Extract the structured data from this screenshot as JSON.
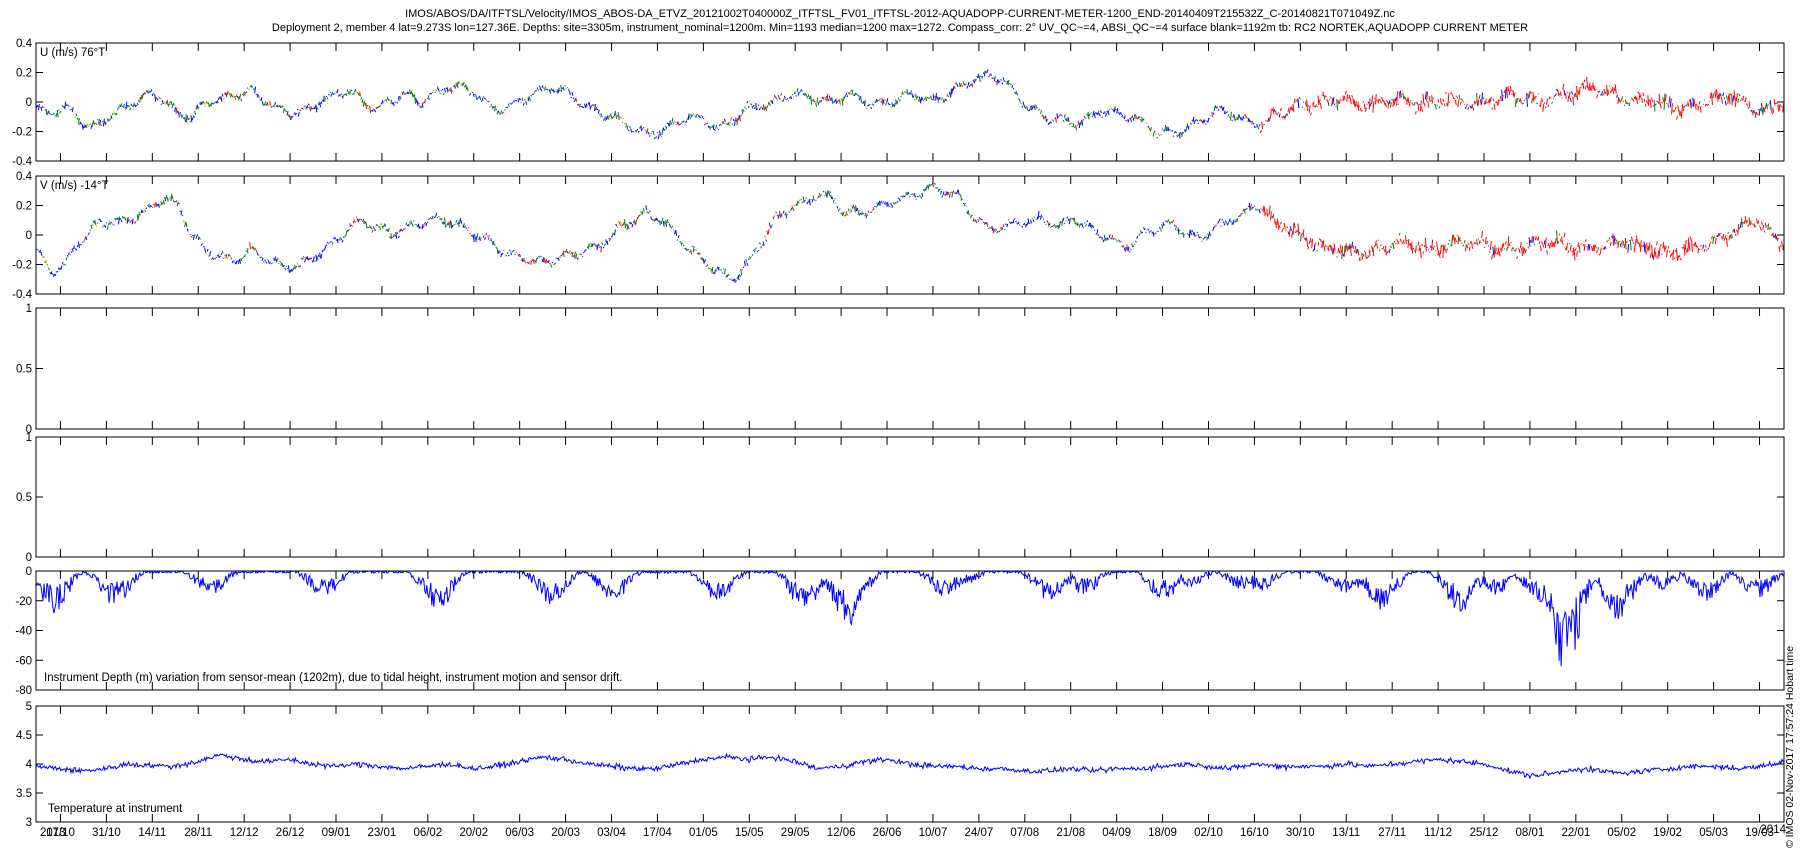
{
  "title_line1": "IMOS/ABOS/DA/ITFTSL/Velocity/IMOS_ABOS-DA_ETVZ_20121002T040000Z_ITFTSL_FV01_ITFTSL-2012-AQUADOPP-CURRENT-METER-1200_END-20140409T215532Z_C-20140821T071049Z.nc",
  "title_line2": "Deployment 2, member 4 lat=9.273S lon=127.36E. Depths: site=3305m, instrument_nominal=1200m. Min=1193 median=1200 max=1272. Compass_corr: 2° UV_QC~=4, ABSI_QC~=4 surface blank=1192m tb: RC2 NORTEK,AQUADOPP CURRENT METER",
  "footer": "© IMOS 02-Nov-2017 17:57:24 Hobart time",
  "colors": {
    "blue": "#0000ff",
    "green": "#007f00",
    "red": "#ff0000",
    "yellow": "#e0e000",
    "magenta": "#ff00ff"
  },
  "chart_data": [
    {
      "type": "line",
      "label": "U (m/s) 76°T",
      "ylim": [
        -0.4,
        0.4
      ],
      "yticks": [
        "0.4",
        "0.2",
        "0",
        "-0.2",
        "-0.4"
      ],
      "series_colors": [
        "blue",
        "green",
        "red",
        "yellow",
        "magenta"
      ],
      "trend": [
        -0.05,
        -0.08,
        -0.03,
        -0.12,
        -0.18,
        -0.1,
        -0.05,
        0.0,
        0.05,
        0.02,
        -0.08,
        -0.1,
        0.0,
        0.02,
        0.05,
        0.08,
        0.02,
        -0.05,
        -0.08,
        -0.05,
        0.0,
        0.05,
        0.08,
        0.0,
        -0.05,
        0.02,
        0.05,
        0.0,
        0.05,
        0.1,
        0.1,
        0.05,
        -0.05,
        -0.05,
        0.0,
        0.05,
        0.1,
        0.08,
        0.02,
        -0.05,
        -0.08,
        -0.12,
        -0.18,
        -0.22,
        -0.2,
        -0.15,
        -0.1,
        -0.12,
        -0.18,
        -0.12,
        -0.05,
        -0.02,
        0.0,
        0.05,
        0.05,
        0.02,
        0.0,
        0.05,
        0.02,
        -0.02,
        0.0,
        0.03,
        0.05,
        0.0,
        0.05,
        0.1,
        0.15,
        0.18,
        0.15,
        0.05,
        -0.05,
        -0.1,
        -0.12,
        -0.15,
        -0.12,
        -0.05,
        -0.08,
        -0.1,
        -0.15,
        -0.2,
        -0.22,
        -0.18,
        -0.12,
        -0.05,
        -0.08,
        -0.12,
        -0.15,
        -0.1,
        -0.05,
        -0.02,
        0.0,
        0.0,
        0.02,
        -0.03,
        -0.02,
        0.0,
        0.02,
        -0.02,
        0.0,
        0.02,
        0.0,
        -0.02,
        0.0,
        0.02,
        0.05,
        0.02,
        0.0,
        0.05,
        0.05,
        0.1,
        0.08,
        0.05,
        0.0,
        0.02,
        0.0,
        -0.02,
        -0.05,
        -0.02,
        0.02,
        0.05,
        0.0,
        -0.05,
        -0.05,
        0.0
      ]
    },
    {
      "type": "line",
      "label": "V (m/s) -14°T",
      "ylim": [
        -0.4,
        0.4
      ],
      "yticks": [
        "0.4",
        "0.2",
        "0",
        "-0.2",
        "-0.4"
      ],
      "series_colors": [
        "blue",
        "green",
        "red",
        "yellow",
        "magenta"
      ],
      "trend": [
        -0.1,
        -0.25,
        -0.2,
        -0.05,
        0.05,
        0.1,
        0.08,
        0.12,
        0.18,
        0.25,
        0.2,
        0.0,
        -0.12,
        -0.15,
        -0.18,
        -0.1,
        -0.15,
        -0.2,
        -0.22,
        -0.18,
        -0.12,
        -0.05,
        0.05,
        0.1,
        0.05,
        0.0,
        0.05,
        0.08,
        0.1,
        0.1,
        0.05,
        0.0,
        -0.05,
        -0.12,
        -0.15,
        -0.18,
        -0.18,
        -0.15,
        -0.12,
        -0.1,
        -0.05,
        0.05,
        0.1,
        0.15,
        0.1,
        0.0,
        -0.1,
        -0.18,
        -0.25,
        -0.3,
        -0.2,
        -0.05,
        0.1,
        0.18,
        0.22,
        0.28,
        0.25,
        0.15,
        0.15,
        0.18,
        0.22,
        0.25,
        0.28,
        0.32,
        0.3,
        0.25,
        0.12,
        0.05,
        0.05,
        0.08,
        0.1,
        0.1,
        0.05,
        0.12,
        0.05,
        0.0,
        -0.05,
        -0.08,
        0.02,
        0.05,
        0.08,
        0.0,
        -0.02,
        0.05,
        0.1,
        0.15,
        0.2,
        0.1,
        0.05,
        -0.02,
        -0.05,
        -0.08,
        -0.1,
        -0.12,
        -0.1,
        -0.08,
        -0.05,
        -0.08,
        -0.1,
        -0.08,
        -0.05,
        -0.05,
        -0.08,
        -0.1,
        -0.1,
        -0.08,
        -0.05,
        -0.05,
        -0.08,
        -0.1,
        -0.08,
        -0.05,
        -0.05,
        -0.08,
        -0.1,
        -0.12,
        -0.1,
        -0.08,
        -0.05,
        0.0,
        0.05,
        0.1,
        0.0,
        -0.05
      ]
    },
    {
      "type": "line",
      "label": "",
      "ylim": [
        0,
        1
      ],
      "yticks": [
        "1",
        "0.5",
        "0"
      ]
    },
    {
      "type": "line",
      "label": "",
      "ylim": [
        0,
        1
      ],
      "yticks": [
        "1",
        "0.5",
        "0"
      ]
    },
    {
      "type": "line",
      "label": "Instrument Depth (m) variation from sensor-mean (1202m), due to tidal height, instrument motion and sensor drift.",
      "ylim": [
        -80,
        0
      ],
      "yticks": [
        "0",
        "-20",
        "-40",
        "-60",
        "-80"
      ],
      "baseline": 3,
      "spring_dips": [
        {
          "t": 0.01,
          "depth": 30
        },
        {
          "t": 0.045,
          "depth": 25
        },
        {
          "t": 0.1,
          "depth": 18
        },
        {
          "t": 0.165,
          "depth": 20
        },
        {
          "t": 0.23,
          "depth": 28
        },
        {
          "t": 0.295,
          "depth": 25
        },
        {
          "t": 0.33,
          "depth": 22
        },
        {
          "t": 0.39,
          "depth": 22
        },
        {
          "t": 0.44,
          "depth": 30
        },
        {
          "t": 0.465,
          "depth": 40
        },
        {
          "t": 0.52,
          "depth": 20
        },
        {
          "t": 0.58,
          "depth": 22
        },
        {
          "t": 0.645,
          "depth": 22
        },
        {
          "t": 0.7,
          "depth": 15
        },
        {
          "t": 0.75,
          "depth": 18
        },
        {
          "t": 0.77,
          "depth": 28
        },
        {
          "t": 0.815,
          "depth": 30
        },
        {
          "t": 0.86,
          "depth": 25
        },
        {
          "t": 0.875,
          "depth": 70
        },
        {
          "t": 0.905,
          "depth": 35
        },
        {
          "t": 0.955,
          "depth": 22
        },
        {
          "t": 0.985,
          "depth": 20
        }
      ],
      "extra_dips": [
        {
          "t": 0.53,
          "depth": 12
        },
        {
          "t": 0.6,
          "depth": 18
        },
        {
          "t": 0.66,
          "depth": 12
        },
        {
          "t": 0.69,
          "depth": 14
        },
        {
          "t": 0.745,
          "depth": 12
        },
        {
          "t": 0.82,
          "depth": 20
        },
        {
          "t": 0.835,
          "depth": 18
        },
        {
          "t": 0.93,
          "depth": 14
        }
      ]
    },
    {
      "type": "line",
      "label": "Temperature at instrument",
      "ylim": [
        3,
        5.5
      ],
      "yticks": [
        "5",
        "4.5",
        "4",
        "3.5",
        "3"
      ],
      "trend": [
        4.2,
        4.15,
        4.1,
        4.15,
        4.25,
        4.22,
        4.2,
        4.3,
        4.45,
        4.35,
        4.3,
        4.35,
        4.25,
        4.2,
        4.25,
        4.2,
        4.15,
        4.2,
        4.25,
        4.15,
        4.2,
        4.3,
        4.4,
        4.35,
        4.25,
        4.2,
        4.15,
        4.15,
        4.25,
        4.35,
        4.4,
        4.35,
        4.4,
        4.3,
        4.15,
        4.2,
        4.3,
        4.35,
        4.25,
        4.2,
        4.2,
        4.15,
        4.15,
        4.1,
        4.1,
        4.15,
        4.1,
        4.15,
        4.15,
        4.2,
        4.25,
        4.2,
        4.15,
        4.25,
        4.2,
        4.2,
        4.2,
        4.25,
        4.2,
        4.25,
        4.3,
        4.35,
        4.3,
        4.25,
        4.1,
        4.0,
        4.05,
        4.15,
        4.1,
        4.05,
        4.1,
        4.15,
        4.2,
        4.2,
        4.15,
        4.2,
        4.3
      ]
    }
  ],
  "x_axis": {
    "first_label": "2013",
    "last_label": "2014",
    "ticks": [
      "17/10",
      "31/10",
      "14/11",
      "28/11",
      "12/12",
      "26/12",
      "09/01",
      "23/01",
      "06/02",
      "20/02",
      "06/03",
      "20/03",
      "03/04",
      "17/04",
      "01/05",
      "15/05",
      "29/05",
      "12/06",
      "26/06",
      "10/07",
      "24/07",
      "07/08",
      "21/08",
      "04/09",
      "18/09",
      "02/10",
      "16/10",
      "30/10",
      "13/11",
      "27/11",
      "11/12",
      "25/12",
      "08/01",
      "22/01",
      "05/02",
      "19/02",
      "05/03",
      "19/03"
    ]
  }
}
